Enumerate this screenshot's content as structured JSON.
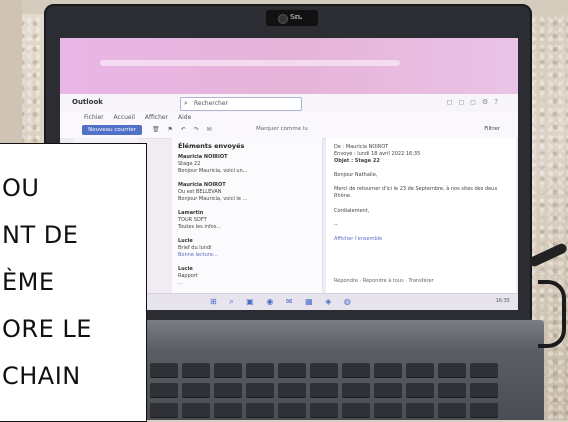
{
  "overlay": {
    "lines": [
      "OU",
      "NT DE",
      "ÈME",
      "ORE LE",
      "CHAIN"
    ]
  },
  "webcam": {
    "label": "𝕊𝕟."
  },
  "outlook": {
    "app_name": "Outlook",
    "search_placeholder": "Rechercher",
    "ribbon_tabs": [
      "Fichier",
      "Accueil",
      "Afficher",
      "Aide"
    ],
    "new_mail_label": "Nouveau courrier",
    "read_button": "Marquer comme lu",
    "filter_button": "Filtrer",
    "list_header": "Éléments envoyés",
    "messages": [
      {
        "from": "Mauricia NOIRIOT",
        "subject": "Stage 22",
        "preview": "Bonjour Mauricia, voici un..."
      },
      {
        "from": "Mauricia NOIROT",
        "subject": "Ou est BELLEVAN",
        "preview": "Bonjour Mauricia, voici le ..."
      },
      {
        "from": "Lamartin",
        "subject": "TOUR SOFT",
        "preview": "Toutes les infos..."
      },
      {
        "from": "Lucie",
        "subject": "Brief du lundi",
        "preview": "Bonne lecture..."
      },
      {
        "from": "Lucie",
        "subject": "Rapport",
        "preview": "..."
      }
    ],
    "reading": {
      "to": "De : Mauricia NOIROT",
      "sent": "Envoyé : lundi 18 avril 2022 16:35",
      "subject": "Objet : Stage 22",
      "greeting": "Bonjour Nathalie,",
      "body": "Merci de retourner d'ici le 23 de Septembre, à nos sites des deux Rhône.",
      "closing": "Cordialement,",
      "signature": "--",
      "link": "Afficher l'ensemble",
      "actions": [
        "Répondre",
        "Répondre à tous",
        "Transférer"
      ]
    },
    "tray_time": "16:35"
  }
}
